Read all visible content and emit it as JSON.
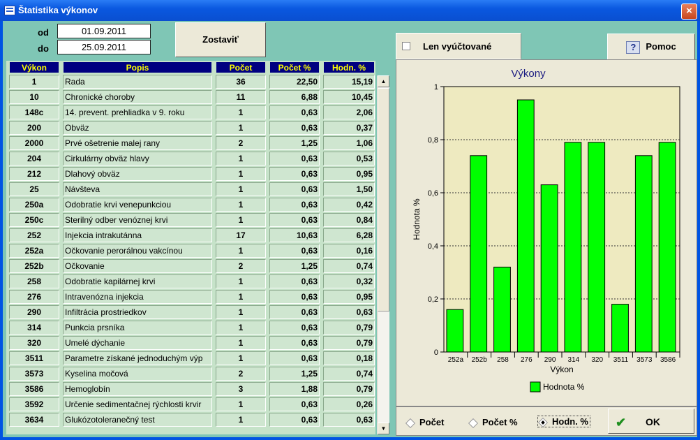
{
  "window": {
    "title": "Štatistika výkonov",
    "close_glyph": "×"
  },
  "filter": {
    "od_label": "od",
    "od_value": "01.09.2011",
    "do_label": "do",
    "do_value": "25.09.2011",
    "zostavit_label": "Zostaviť"
  },
  "table": {
    "headers": [
      "Výkon",
      "Popis",
      "Počet",
      "Počet %",
      "Hodn. %"
    ],
    "rows": [
      [
        "1",
        "Rada",
        "36",
        "22,50",
        "15,19"
      ],
      [
        "10",
        "Chronické choroby",
        "11",
        "6,88",
        "10,45"
      ],
      [
        "148c",
        "14. prevent. prehliadka v 9. roku",
        "1",
        "0,63",
        "2,06"
      ],
      [
        "200",
        "Obväz",
        "1",
        "0,63",
        "0,37"
      ],
      [
        "2000",
        "Prvé ošetrenie malej rany",
        "2",
        "1,25",
        "1,06"
      ],
      [
        "204",
        "Cirkulárny obväz hlavy",
        "1",
        "0,63",
        "0,53"
      ],
      [
        "212",
        "Dlahový obväz",
        "1",
        "0,63",
        "0,95"
      ],
      [
        "25",
        "Návšteva",
        "1",
        "0,63",
        "1,50"
      ],
      [
        "250a",
        "Odobratie krvi venepunkciou",
        "1",
        "0,63",
        "0,42"
      ],
      [
        "250c",
        "Sterilný odber venóznej krvi",
        "1",
        "0,63",
        "0,84"
      ],
      [
        "252",
        "Injekcia intrakutánna",
        "17",
        "10,63",
        "6,28"
      ],
      [
        "252a",
        "Očkovanie perorálnou vakcínou",
        "1",
        "0,63",
        "0,16"
      ],
      [
        "252b",
        "Očkovanie",
        "2",
        "1,25",
        "0,74"
      ],
      [
        "258",
        "Odobratie kapilárnej krvi",
        "1",
        "0,63",
        "0,32"
      ],
      [
        "276",
        "Intravenózna injekcia",
        "1",
        "0,63",
        "0,95"
      ],
      [
        "290",
        "Infiltrácia prostriedkov",
        "1",
        "0,63",
        "0,63"
      ],
      [
        "314",
        "Punkcia prsníka",
        "1",
        "0,63",
        "0,79"
      ],
      [
        "320",
        "Umelé dýchanie",
        "1",
        "0,63",
        "0,79"
      ],
      [
        "3511",
        "Parametre získané jednoduchým výp",
        "1",
        "0,63",
        "0,18"
      ],
      [
        "3573",
        "Kyselina močová",
        "2",
        "1,25",
        "0,74"
      ],
      [
        "3586",
        "Hemoglobín",
        "3",
        "1,88",
        "0,79"
      ],
      [
        "3592",
        "Určenie sedimentačnej rýchlosti krvir",
        "1",
        "0,63",
        "0,26"
      ],
      [
        "3634",
        "Glukózotoleranečný test",
        "1",
        "0,63",
        "0,63"
      ]
    ]
  },
  "scroll": {
    "up_glyph": "▲",
    "down_glyph": "▼"
  },
  "side": {
    "len_label": "Len vyúčtované",
    "help_glyph": "?",
    "help_label": "Pomoc"
  },
  "radios": {
    "pocet": "Počet",
    "pocet_pct": "Počet %",
    "hodn_pct": "Hodn. %",
    "selected": "hodn_pct"
  },
  "ok_label": "OK",
  "ok_glyph": "✔",
  "chart_data": {
    "type": "bar",
    "title": "Výkony",
    "xlabel": "Výkon",
    "ylabel": "Hodnota %",
    "categories": [
      "252a",
      "252b",
      "258",
      "276",
      "290",
      "314",
      "320",
      "3511",
      "3573",
      "3586"
    ],
    "series": [
      {
        "name": "Hodnota %",
        "values": [
          0.16,
          0.74,
          0.32,
          0.95,
          0.63,
          0.79,
          0.79,
          0.18,
          0.74,
          0.79
        ]
      }
    ],
    "ylim": [
      0,
      1
    ],
    "yticks": [
      "0",
      "0,2",
      "0,4",
      "0,6",
      "0,8",
      "1"
    ],
    "colors": {
      "bar": "#00ff00",
      "plot_bg": "#eeeac0"
    },
    "grid": true,
    "legend": "bottom"
  }
}
